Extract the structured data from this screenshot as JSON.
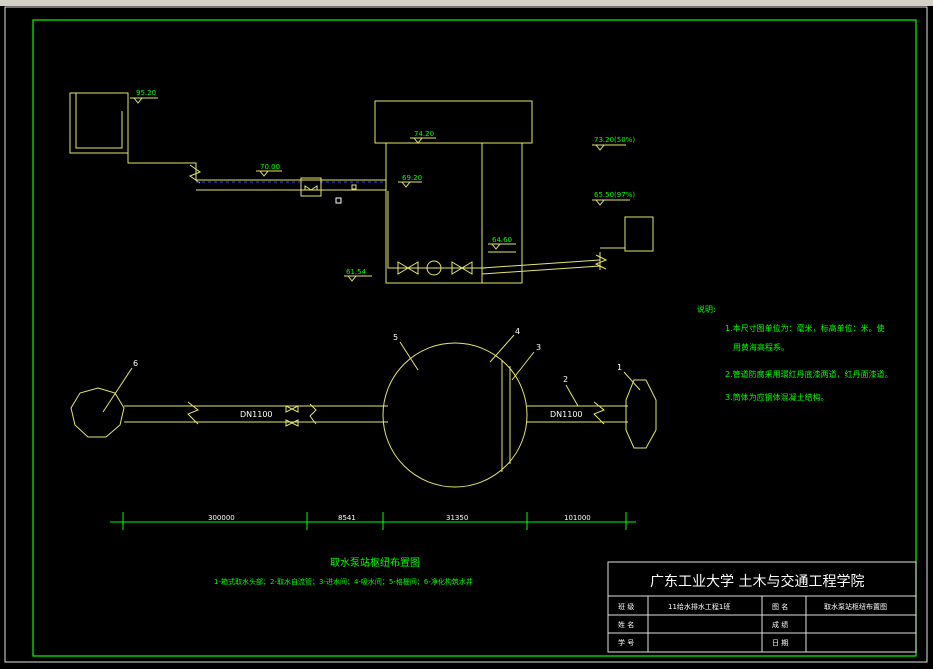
{
  "elevations": {
    "e95": "95.20",
    "e74": "74.20",
    "e70": "70.00",
    "e69": "69.20",
    "e73": "73.20(50%)",
    "e65": "65.50(97%)",
    "e64": "64.60",
    "e61": "61.54"
  },
  "pipe_labels": {
    "left": "DN1100",
    "right": "DN1100"
  },
  "numbers": {
    "n1": "1",
    "n2": "2",
    "n3": "3",
    "n4": "4",
    "n5": "5",
    "n6": "6"
  },
  "dimensions": {
    "d1": "300000",
    "d2": "8541",
    "d3": "31350",
    "d4": "101000"
  },
  "notes": {
    "heading": "说明:",
    "line1": "1.本尺寸图单位为：毫米，标高单位：米。使",
    "line1b": "用黄海高程系。",
    "line2": "2.管道防腐采用環红丹底漆两道，红丹面漆道。",
    "line3": "3.筒体为应钢体混凝土结构。"
  },
  "caption": {
    "title": "取水泵站枢纽布置图",
    "legend": "1-箱式取水头部；2-取水自流管；3-进水间；4-吸水间；5-格栅间；6-净化构筑水井"
  },
  "title_block": {
    "school": "广东工业大学    土木与交通工程学院",
    "rows": [
      {
        "l1": "班 级",
        "v1": "11给水排水工程1班",
        "l2": "图 名",
        "v2": "取水泵站枢纽布置图"
      },
      {
        "l1": "姓 名",
        "v1": "",
        "l2": "成 绩",
        "v2": ""
      },
      {
        "l1": "学 号",
        "v1": "",
        "l2": "日 期",
        "v2": ""
      }
    ]
  },
  "colors": {
    "frame": "#00ff00",
    "lines": "#e6e66e",
    "text": "#ffffff",
    "elev": "#00ff00",
    "pipe_dash": "#4040ff"
  }
}
